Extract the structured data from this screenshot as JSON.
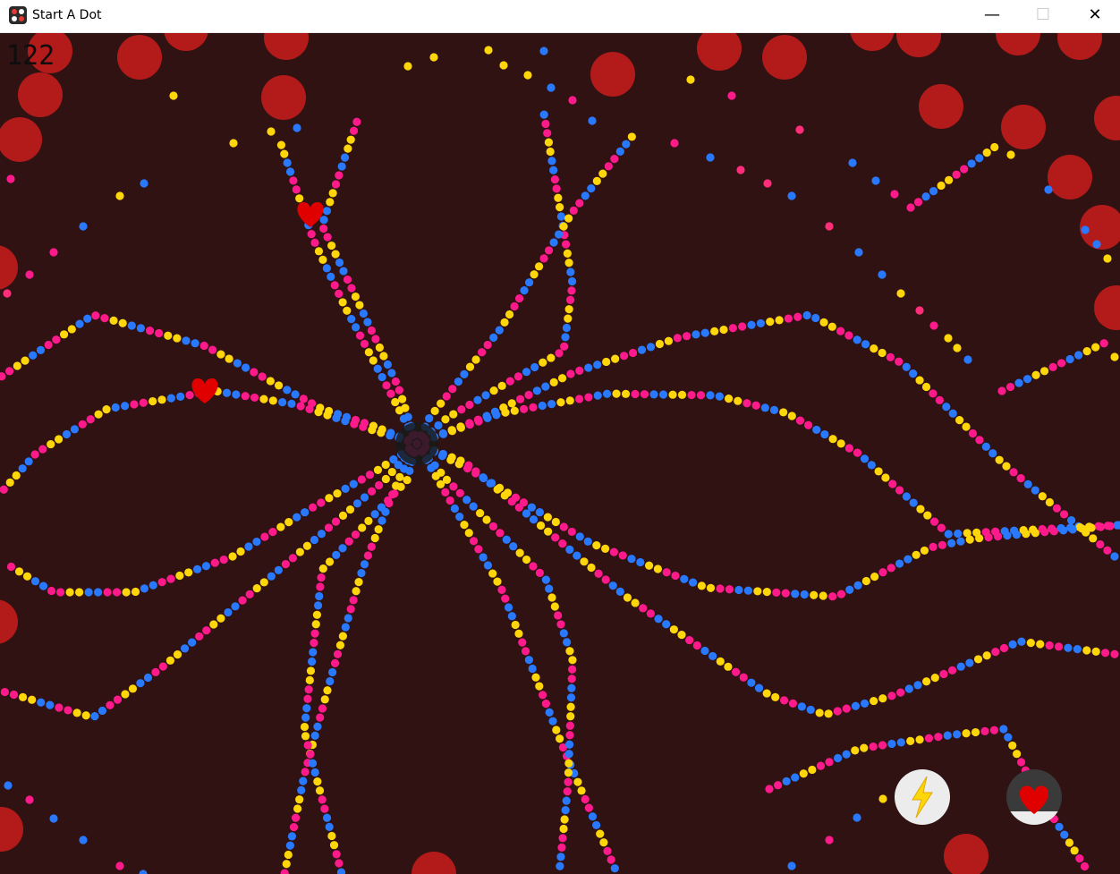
{
  "window": {
    "title": "Start A Dot",
    "minimize_glyph": "—",
    "maximize_glyph": "☐",
    "close_glyph": "✕"
  },
  "game": {
    "score": "122",
    "background_color": "#301212",
    "dot_colors": [
      "#ff1a8c",
      "#2979ff",
      "#ffd60a",
      "#ff2d7a"
    ],
    "enemy_color": "#b31b1b",
    "heart_color": "#e00000",
    "center_core": "dark-core",
    "powerups": [
      {
        "name": "lightning",
        "icon": "lightning-icon",
        "state": "ready"
      },
      {
        "name": "heart",
        "icon": "heart-icon",
        "state": "charging",
        "charge": 0.75
      }
    ]
  }
}
